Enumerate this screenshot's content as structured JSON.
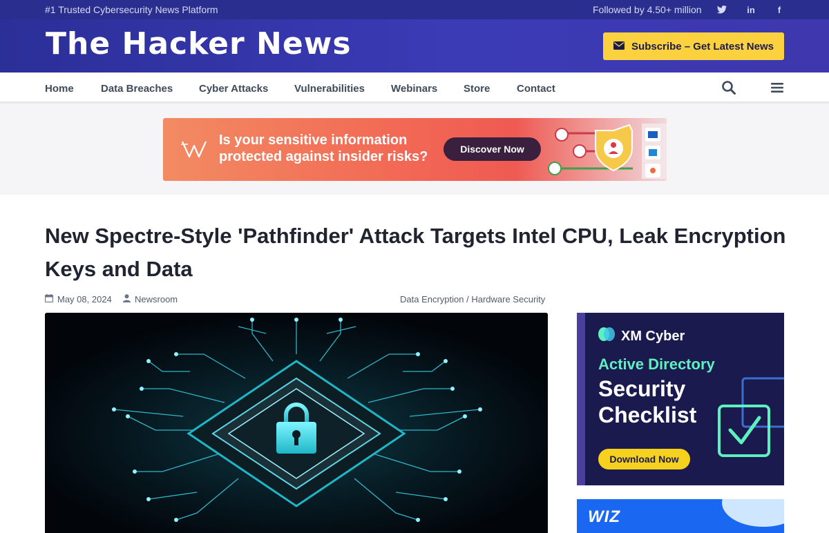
{
  "topbar": {
    "tagline": "#1 Trusted Cybersecurity News Platform",
    "followed": "Followed by 4.50+ million",
    "social_icons": [
      "twitter-icon",
      "linkedin-icon",
      "facebook-icon"
    ]
  },
  "header": {
    "logo": "The Hacker News",
    "subscribe_label": "Subscribe – Get Latest News"
  },
  "nav": {
    "items": [
      "Home",
      "Data Breaches",
      "Cyber Attacks",
      "Vulnerabilities",
      "Webinars",
      "Store",
      "Contact"
    ],
    "icons": [
      "search-icon",
      "menu-icon"
    ]
  },
  "banner_ad": {
    "text_line1": "Is your sensitive information",
    "text_line2": "protected against insider risks?",
    "cta": "Discover Now"
  },
  "article": {
    "title": "New Spectre-Style 'Pathfinder' Attack Targets Intel CPU, Leak Encryption Keys and Data",
    "date": "May 08, 2024",
    "author": "Newsroom",
    "tag1": "Data Encryption",
    "tag_sep": " / ",
    "tag2": "Hardware Security"
  },
  "sidebar_ad1": {
    "brand": "XM Cyber",
    "headline_small": "Active Directory",
    "headline_line1": "Security",
    "headline_line2": "Checklist",
    "cta": "Download Now"
  },
  "sidebar_ad2": {
    "brand": "WIZ"
  },
  "colors": {
    "topbar": "#2a2f8f",
    "header": "#3b3bb6",
    "subscribe": "#fbd13f",
    "nav_text": "#3f4a5a"
  }
}
